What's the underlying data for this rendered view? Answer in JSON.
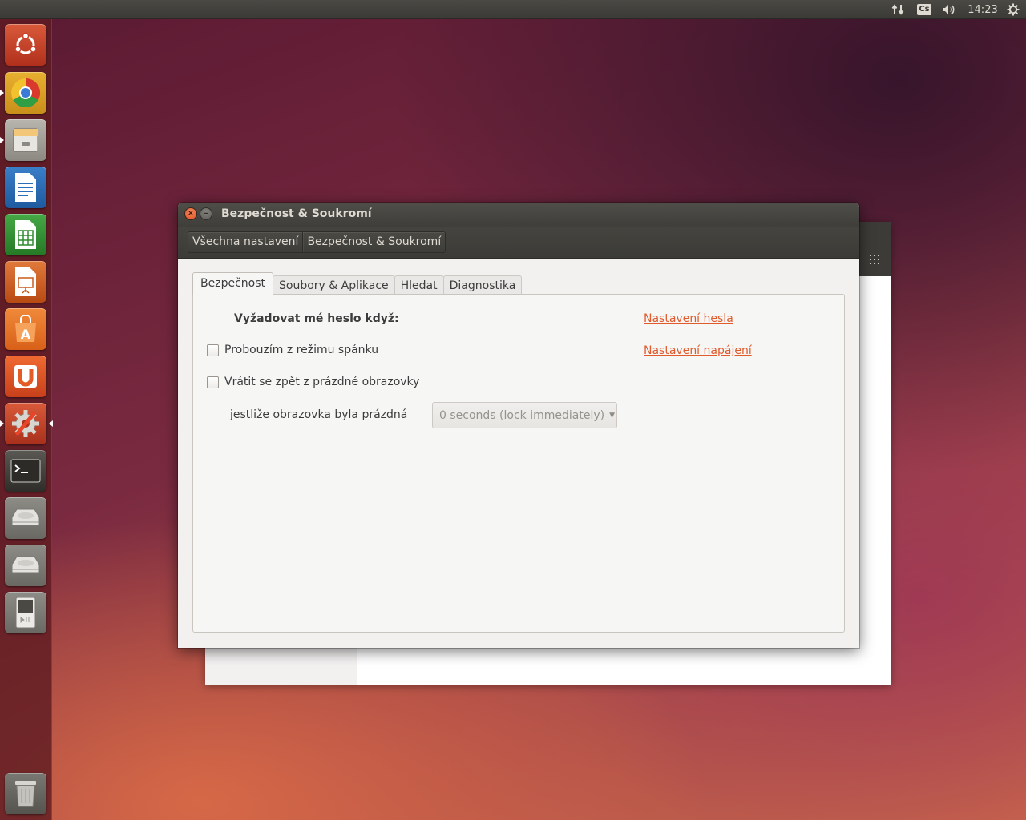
{
  "top_panel": {
    "keyboard_layout": "Cs",
    "clock": "14:23",
    "icons": [
      "network-icon",
      "keyboard-indicator",
      "sound-icon",
      "session-gear-icon"
    ]
  },
  "launcher": {
    "items": [
      {
        "name": "dash-ubuntu-icon",
        "color": "#c8402a"
      },
      {
        "name": "chrome-icon",
        "color": "#d8a020"
      },
      {
        "name": "files-icon",
        "color": "#9c9890"
      },
      {
        "name": "writer-icon",
        "color": "#2c6db5"
      },
      {
        "name": "calc-icon",
        "color": "#2e8b2e"
      },
      {
        "name": "impress-icon",
        "color": "#c85a1e"
      },
      {
        "name": "software-center-icon",
        "color": "#e8762b"
      },
      {
        "name": "ubuntu-one-icon",
        "color": "#e35b25"
      },
      {
        "name": "system-settings-icon",
        "color": "#d8402a"
      },
      {
        "name": "terminal-icon",
        "color": "#3c3b37"
      },
      {
        "name": "drive-icon",
        "color": "#a8a6a0"
      },
      {
        "name": "drive-icon",
        "color": "#a8a6a0"
      },
      {
        "name": "media-player-icon",
        "color": "#b0aea8"
      },
      {
        "name": "trash-icon",
        "color": "#8a8880"
      }
    ]
  },
  "dialog": {
    "title": "Bezpečnost & Soukromí",
    "breadcrumb": [
      "Všechna nastavení",
      "Bezpečnost & Soukromí"
    ],
    "tabs": [
      "Bezpečnost",
      "Soubory & Aplikace",
      "Hledat",
      "Diagnostika"
    ],
    "active_tab": "Bezpečnost",
    "security": {
      "heading": "Vyžadovat mé heslo když:",
      "password_link": "Nastavení hesla",
      "power_link": "Nastavení napájení",
      "checkbox_wake": {
        "label": "Probouzím z režimu spánku",
        "checked": false
      },
      "checkbox_blank": {
        "label": "Vrátit se zpět z prázdné obrazovky",
        "checked": false
      },
      "blank_label": "jestliže obrazovka byla prázdná",
      "lock_dropdown": {
        "value": "0 seconds (lock immediately)",
        "enabled": false
      }
    }
  },
  "colors": {
    "accent_link": "#e05a2b",
    "panel_dark": "#3c3b37"
  }
}
